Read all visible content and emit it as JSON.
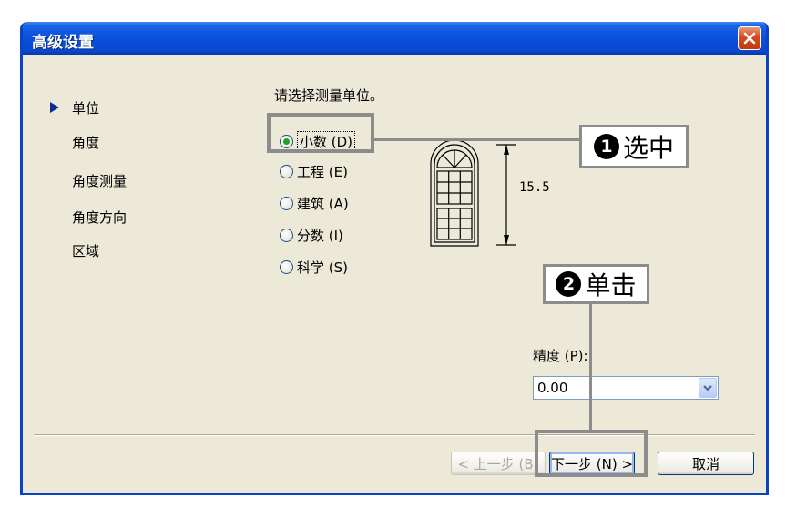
{
  "window": {
    "title": "高级设置"
  },
  "nav": {
    "items": [
      {
        "label": "单位",
        "active": true
      },
      {
        "label": "角度",
        "active": false
      },
      {
        "label": "角度测量",
        "active": false
      },
      {
        "label": "角度方向",
        "active": false
      },
      {
        "label": "区域",
        "active": false
      }
    ]
  },
  "prompt": "请选择测量单位。",
  "radios": [
    {
      "label": "小数 (D)",
      "checked": true
    },
    {
      "label": "工程 (E)",
      "checked": false
    },
    {
      "label": "建筑 (A)",
      "checked": false
    },
    {
      "label": "分数 (I)",
      "checked": false
    },
    {
      "label": "科学 (S)",
      "checked": false
    }
  ],
  "preview": {
    "dimension": "15.5"
  },
  "annotations": {
    "step1": {
      "number": "1",
      "text": "选中"
    },
    "step2": {
      "number": "2",
      "text": "单击"
    }
  },
  "precision": {
    "label": "精度 (P):",
    "value": "0.00"
  },
  "buttons": {
    "back": "< 上一步 (B)",
    "next": "下一步 (N) >",
    "cancel": "取消"
  },
  "colors": {
    "title_bar": "#0b4fd9",
    "dialog_bg": "#ece9d8",
    "annotation_gray": "#8c8c8c",
    "radio_check": "#21a121"
  }
}
